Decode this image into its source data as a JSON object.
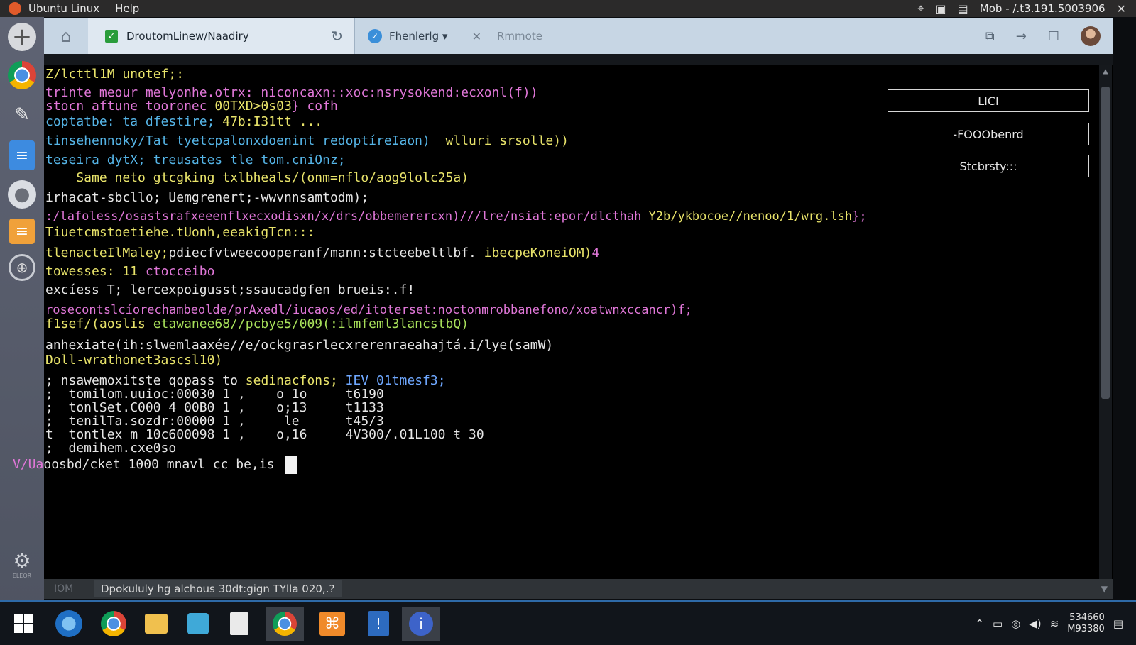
{
  "topbar": {
    "app_name": "Ubuntu Linux",
    "menu_help": "Help",
    "status_right": "Mob - /.t3.191.5003906"
  },
  "tabs": {
    "active_title": "DroutomLinew/Naadiry",
    "tab2_title": "Fhenlerlg ▾",
    "tab3_title": "Rmmote"
  },
  "terminal": {
    "lines": [
      {
        "text": "Z/lcttl1M unotef;:",
        "color": "yellow"
      },
      {
        "text": "trinte meour melyonhe.otrx: niconcaxn::xoc:nsrysokend:ecxonl(f))",
        "color": "magenta"
      },
      {
        "text": "stocn aftune tooronec ",
        "color": "magenta"
      },
      {
        "text": "coptatbe: ta dfestire; ",
        "color": "cyan"
      },
      {
        "text": "tinsehennoky/Tat tyetcpalonxdoenint redoptíreIaon)",
        "color": "cyan"
      },
      {
        "text": "teseira dytX; treusates tle tom.cniOnz;",
        "color": "cyan"
      },
      {
        "text": "    Same neto gtcgking txlbheals/(onm=nflo/aog9lolc25a)",
        "color": "yellow"
      },
      {
        "text": "irhacat-sbcllo; Uemgrenert;-wwvnnsamtodm);",
        "color": "white"
      },
      {
        "text": ":/lafoless/osastsrafxeeenflxecxodisxn/x/drs/obbemerercxn)///lre/nsiat:epor/dlcthah",
        "color": "magenta"
      },
      {
        "text": "Tiuetcmstoetiehe.tUonh,eeakigTcn:::",
        "color": "yellow"
      },
      {
        "text": "tlenacteIlMaley;",
        "color": "yellow"
      },
      {
        "text": "towesses: 11 ",
        "color": "yellow"
      },
      {
        "text": "excíess T; lercexpoigusst;ssaucadgfen brueis:.f!",
        "color": "white"
      },
      {
        "text": "rosecontslcíorechambeolde/prAxedl/iucaos/ed/itoterset:noctonmrobbanefono/xoatwnxccancr)f;",
        "color": "magenta"
      },
      {
        "text": "f1sef/(aoslis ",
        "color": "yellow"
      },
      {
        "text": "anhexiate(ih:slwemlaaxée//e/ockgrasrlecxrerenraeahajtá.i/lye(samW)",
        "color": "white"
      },
      {
        "text": "Doll-wrathonet3ascsl10)",
        "color": "yellow"
      },
      {
        "text": "; nsawemoxitste qopass to ",
        "color": "white"
      },
      {
        "text": ";  tomilom.uuioc:00030 1 ,    o 1o     t6190",
        "color": "white"
      },
      {
        "text": ";  tonlSet.C000 4 00B0 1 ,    o;13     t1133",
        "color": "white"
      },
      {
        "text": ";  tenilTa.sozdr:00000 1 ,     le      t45/3",
        "color": "white"
      },
      {
        "text": "t  tontlex m 10c600098 1 ,    o,16     4V300/.01L100 ŧ 30",
        "color": "white"
      },
      {
        "text": ";  demihem.cxe0so",
        "color": "white"
      },
      {
        "text": "oosbd/cket 1000 mnavl cc be,is ",
        "color": "white"
      }
    ],
    "segments": {
      "l3b": "00TXD>0s03",
      "l3c": "} cofh",
      "l4b": "47b:I31tt",
      "l4c": " ...",
      "l5b": "wlluri srsolle))",
      "l9b": "Y2b/ykbocoe//nenoo/1/wrg.lsh",
      "l9c": "};",
      "l11b": "pdiecfvtweecooperanf/mann:stcteebeltlbf.",
      "l11c": "ibecpeKoneiOM)",
      "l11d": "4",
      "l12b": "ctocceibo",
      "l15b": "etawanee68//pcbye5/009(:ilmfeml3lancstbQ)",
      "l18b": "sedinacfons; ",
      "l18c": "IEV 01tmesf3;",
      "prompt_prefix": "V/Ua"
    },
    "side_buttons": [
      "LICI",
      "-FOOObenrd",
      "Stcbrsty:::"
    ]
  },
  "statusbar": {
    "left": "IOM",
    "message": "Dpokululy hg alchous 30dt:gign TYlla 020,.?"
  },
  "taskbar": {
    "clock_time": "534660",
    "clock_date": "M93380"
  },
  "colors": {
    "terminal_bg": "#000000",
    "tab_bar": "#c7d6e4",
    "launcher": "#5e6373",
    "taskbar_accent": "#2e6aa8"
  }
}
